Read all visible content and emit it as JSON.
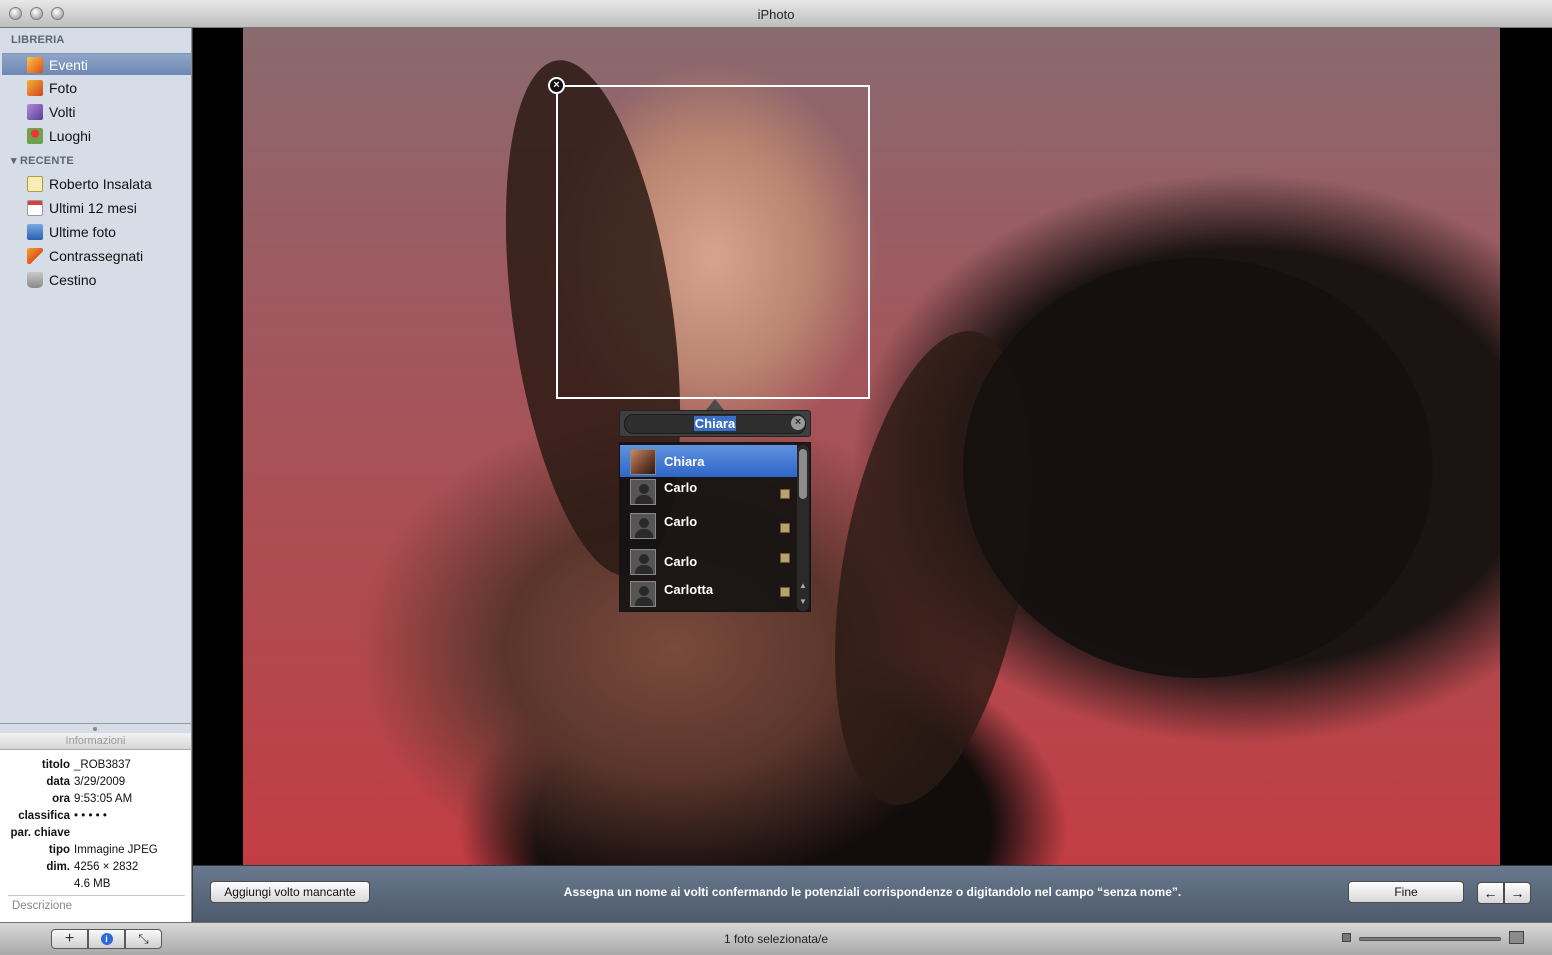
{
  "window": {
    "title": "iPhoto"
  },
  "sidebar": {
    "library_header": "LIBRERIA",
    "library_items": [
      {
        "label": "Eventi",
        "icon": "events-icon",
        "selected": true
      },
      {
        "label": "Foto",
        "icon": "photos-icon"
      },
      {
        "label": "Volti",
        "icon": "faces-icon"
      },
      {
        "label": "Luoghi",
        "icon": "places-icon"
      }
    ],
    "recent_header": "RECENTE",
    "recent_items": [
      {
        "label": "Roberto Insalata",
        "icon": "album-icon"
      },
      {
        "label": "Ultimi 12 mesi",
        "icon": "calendar-icon"
      },
      {
        "label": "Ultime foto",
        "icon": "import-icon"
      },
      {
        "label": "Contrassegnati",
        "icon": "flag-icon"
      },
      {
        "label": "Cestino",
        "icon": "trash-icon"
      }
    ]
  },
  "info": {
    "title": "Informazioni",
    "rows": [
      {
        "key": "titolo",
        "value": "_ROB3837"
      },
      {
        "key": "data",
        "value": "3/29/2009"
      },
      {
        "key": "ora",
        "value": "9:53:05 AM"
      },
      {
        "key": "classifica",
        "value": "• • • • •"
      },
      {
        "key": "par. chiave",
        "value": ""
      },
      {
        "key": "tipo",
        "value": "Immagine JPEG"
      },
      {
        "key": "dim.",
        "value": "4256 × 2832"
      },
      {
        "key": "",
        "value": "4.6 MB"
      }
    ],
    "description_placeholder": "Descrizione"
  },
  "face_tag": {
    "name_value": "Chiara",
    "suggestions": [
      {
        "name": "Chiara",
        "selected": true
      },
      {
        "name": "Carlo"
      },
      {
        "name": "Carlo"
      },
      {
        "name": "Carlo"
      },
      {
        "name": "Carlotta"
      }
    ]
  },
  "actionbar": {
    "add_face_label": "Aggiungi volto mancante",
    "hint": "Assegna un nome ai volti confermando le potenziali corrispondenze o digitandolo nel campo “senza nome”.",
    "done_label": "Fine",
    "prev_icon": "arrow-left-icon",
    "next_icon": "arrow-right-icon"
  },
  "toolbar": {
    "status": "1 foto selezionata/e",
    "add_icon": "plus-icon",
    "info_icon": "info-icon",
    "fullscreen_icon": "fullscreen-icon"
  },
  "colors": {
    "selection_blue": "#6c88b4",
    "sidebar_bg": "#d6dde6",
    "actionbar_bg": "#5b687c"
  }
}
